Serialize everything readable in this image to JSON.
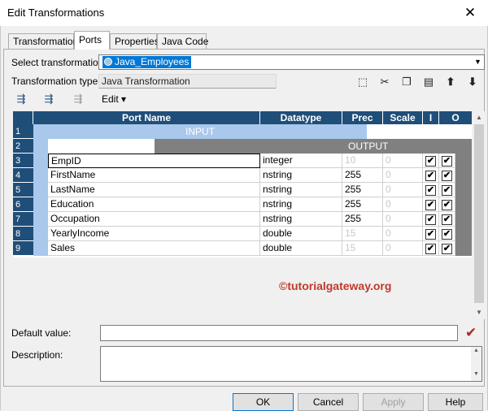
{
  "window": {
    "title": "Edit Transformations",
    "close": "✕"
  },
  "tabs": [
    {
      "label": "Transformation",
      "active": false
    },
    {
      "label": "Ports",
      "active": true
    },
    {
      "label": "Properties",
      "active": false
    },
    {
      "label": "Java Code",
      "active": false
    }
  ],
  "form": {
    "select_label": "Select transformation:",
    "select_value": "Java_Employees",
    "type_label": "Transformation type:",
    "type_value": "Java Transformation"
  },
  "toolbar": {
    "edit_label": "Edit ▾"
  },
  "grid": {
    "headers": [
      "Port Name",
      "Datatype",
      "Prec",
      "Scale",
      "I",
      "O"
    ],
    "row_numbers": [
      "1",
      "2",
      "3",
      "4",
      "5",
      "6",
      "7",
      "8",
      "9"
    ],
    "input_label": "INPUT",
    "output_label": "OUTPUT",
    "rows": [
      {
        "name": "EmpID",
        "datatype": "integer",
        "prec": "10",
        "scale": "0",
        "prec_dim": true,
        "i": true,
        "o": true
      },
      {
        "name": "FirstName",
        "datatype": "nstring",
        "prec": "255",
        "scale": "0",
        "prec_dim": false,
        "i": true,
        "o": true
      },
      {
        "name": "LastName",
        "datatype": "nstring",
        "prec": "255",
        "scale": "0",
        "prec_dim": false,
        "i": true,
        "o": true
      },
      {
        "name": "Education",
        "datatype": "nstring",
        "prec": "255",
        "scale": "0",
        "prec_dim": false,
        "i": true,
        "o": true
      },
      {
        "name": "Occupation",
        "datatype": "nstring",
        "prec": "255",
        "scale": "0",
        "prec_dim": false,
        "i": true,
        "o": true
      },
      {
        "name": "YearlyIncome",
        "datatype": "double",
        "prec": "15",
        "scale": "0",
        "prec_dim": true,
        "i": true,
        "o": true
      },
      {
        "name": "Sales",
        "datatype": "double",
        "prec": "15",
        "scale": "0",
        "prec_dim": true,
        "i": true,
        "o": true
      }
    ]
  },
  "watermark": "©tutorialgateway.org",
  "fields": {
    "default_label": "Default value:",
    "default_value": "",
    "description_label": "Description:",
    "description_value": ""
  },
  "buttons": {
    "ok": "OK",
    "cancel": "Cancel",
    "apply": "Apply",
    "help": "Help"
  },
  "colors": {
    "header": "#1f4e79",
    "input": "#a9c8ec",
    "output": "#808080",
    "watermark": "#c0392b"
  }
}
